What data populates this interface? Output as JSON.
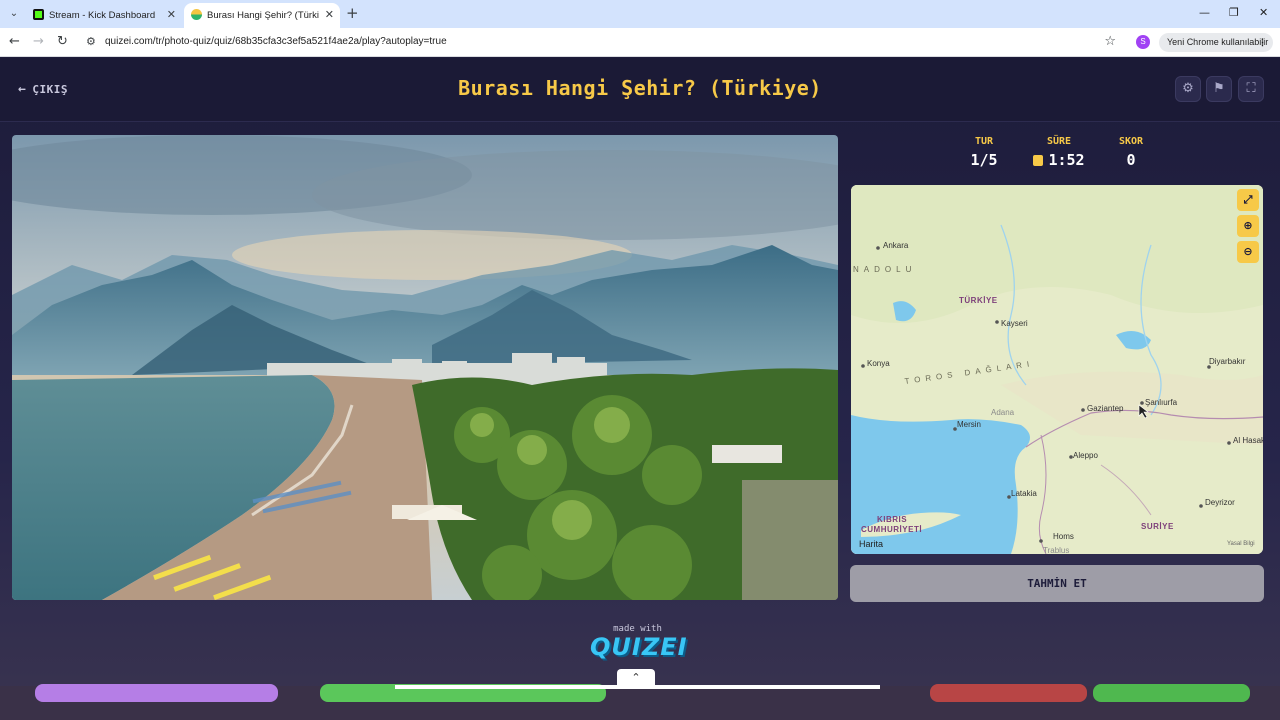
{
  "browser": {
    "tabs": [
      {
        "title": "Stream - Kick Dashboard",
        "active": false
      },
      {
        "title": "Burası Hangi Şehir? (Türkiye) - Quizei",
        "active": true
      }
    ],
    "url": "quizei.com/tr/photo-quiz/quiz/68b35cfa3c3ef5a521f4ae2a/play?autoplay=true",
    "profile_initial": "S",
    "update_label": "Yeni Chrome kullanılabilir"
  },
  "header": {
    "exit_label": "ÇIKIŞ",
    "title": "Burası Hangi Şehir? (Türkiye)"
  },
  "stats": {
    "round_label": "TUR",
    "round_value": "1/5",
    "time_label": "SÜRE",
    "time_value": "1:52",
    "score_label": "SKOR",
    "score_value": "0"
  },
  "map": {
    "country_labels": [
      "TÜRKİYE",
      "SURİYE"
    ],
    "cyprus_label": [
      "KIBRIS",
      "CUMHURİYETİ"
    ],
    "region_labels": [
      "NADOLU",
      "TOROS DAĞLARI"
    ],
    "cities": [
      "Ankara",
      "Kayseri",
      "Konya",
      "Diyarbakır",
      "Şanlıurfa",
      "Gaziantep",
      "Adana",
      "Mersin",
      "Aleppo",
      "Al Hasakah",
      "Latakia",
      "Deyrizor",
      "Homs",
      "Trablus"
    ],
    "attribution": "Harita",
    "legal": "Yasal Bilgi"
  },
  "guess_button": "TAHMİN ET",
  "footer": {
    "made_with": "made with",
    "brand": "QUIZEI"
  },
  "colors": {
    "accent": "#f7c948",
    "background": "#1d1c3a",
    "brand": "#39c6f5"
  }
}
